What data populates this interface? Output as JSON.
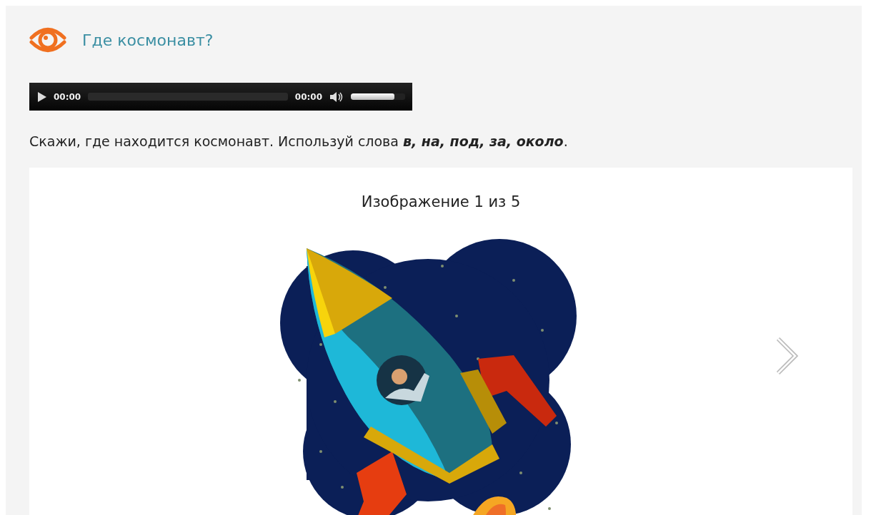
{
  "header": {
    "title": "Где космонавт?"
  },
  "audio_player": {
    "current_time": "00:00",
    "duration": "00:00",
    "progress": {
      "level": 0
    },
    "volume": {
      "level": 0.8
    }
  },
  "instruction": "Скажи, где находится космонавт. Используй слова **в, на, под, за, около**.",
  "gallery": {
    "caption": "Изображение 1 из 5"
  }
}
